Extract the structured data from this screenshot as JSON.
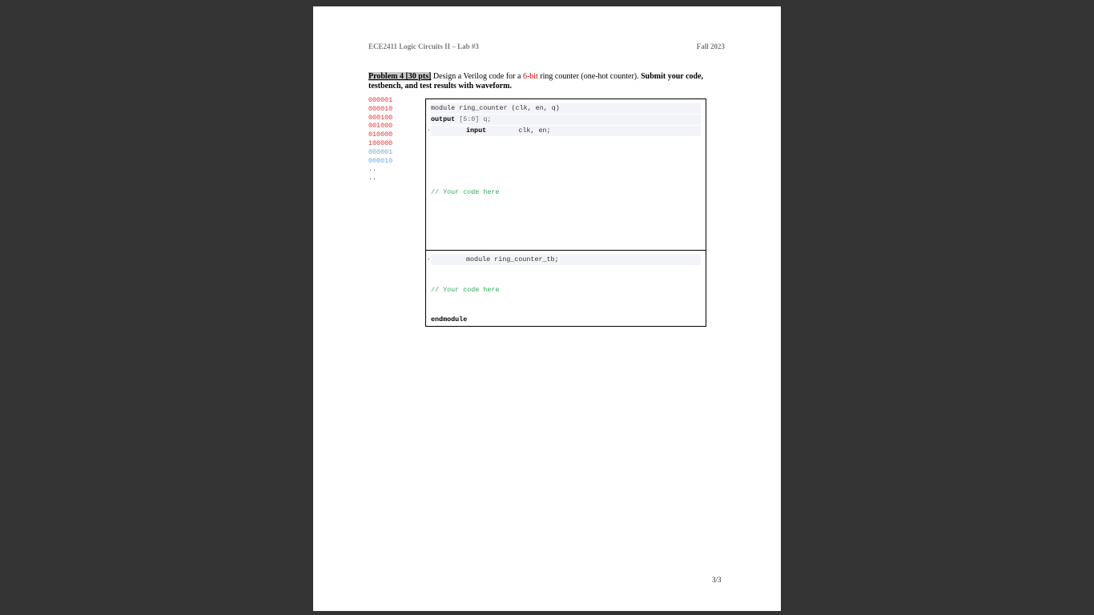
{
  "header": {
    "left": "ECE2411 Logic Circuits II – Lab #3",
    "right": "Fall 2023"
  },
  "problem": {
    "label": "Problem 4 [30 pts]",
    "text_a": " Design a Verilog code for a ",
    "highlight": "6-bit",
    "text_b": " ring counter (one-hot counter). ",
    "bold_tail": "Submit your code, testbench, and test results with waveform."
  },
  "sequence": {
    "red": [
      "000001",
      "000010",
      "000100",
      "001000",
      "010000",
      "100000"
    ],
    "blue": [
      "000001",
      "000010"
    ],
    "dots": [
      "..",
      ".."
    ]
  },
  "code_box": {
    "line1": "module ring_counter (clk, en, q)",
    "line2_kw": "output",
    "line2_rest": " [5:0] q;",
    "line3_kw": "input",
    "line3_rest": "        clk, en;",
    "comment": "// Your code here"
  },
  "tb_box": {
    "line1": "module ring_counter_tb;",
    "comment": "// Your code here",
    "end": "endmodule"
  },
  "page_number": "3/3"
}
